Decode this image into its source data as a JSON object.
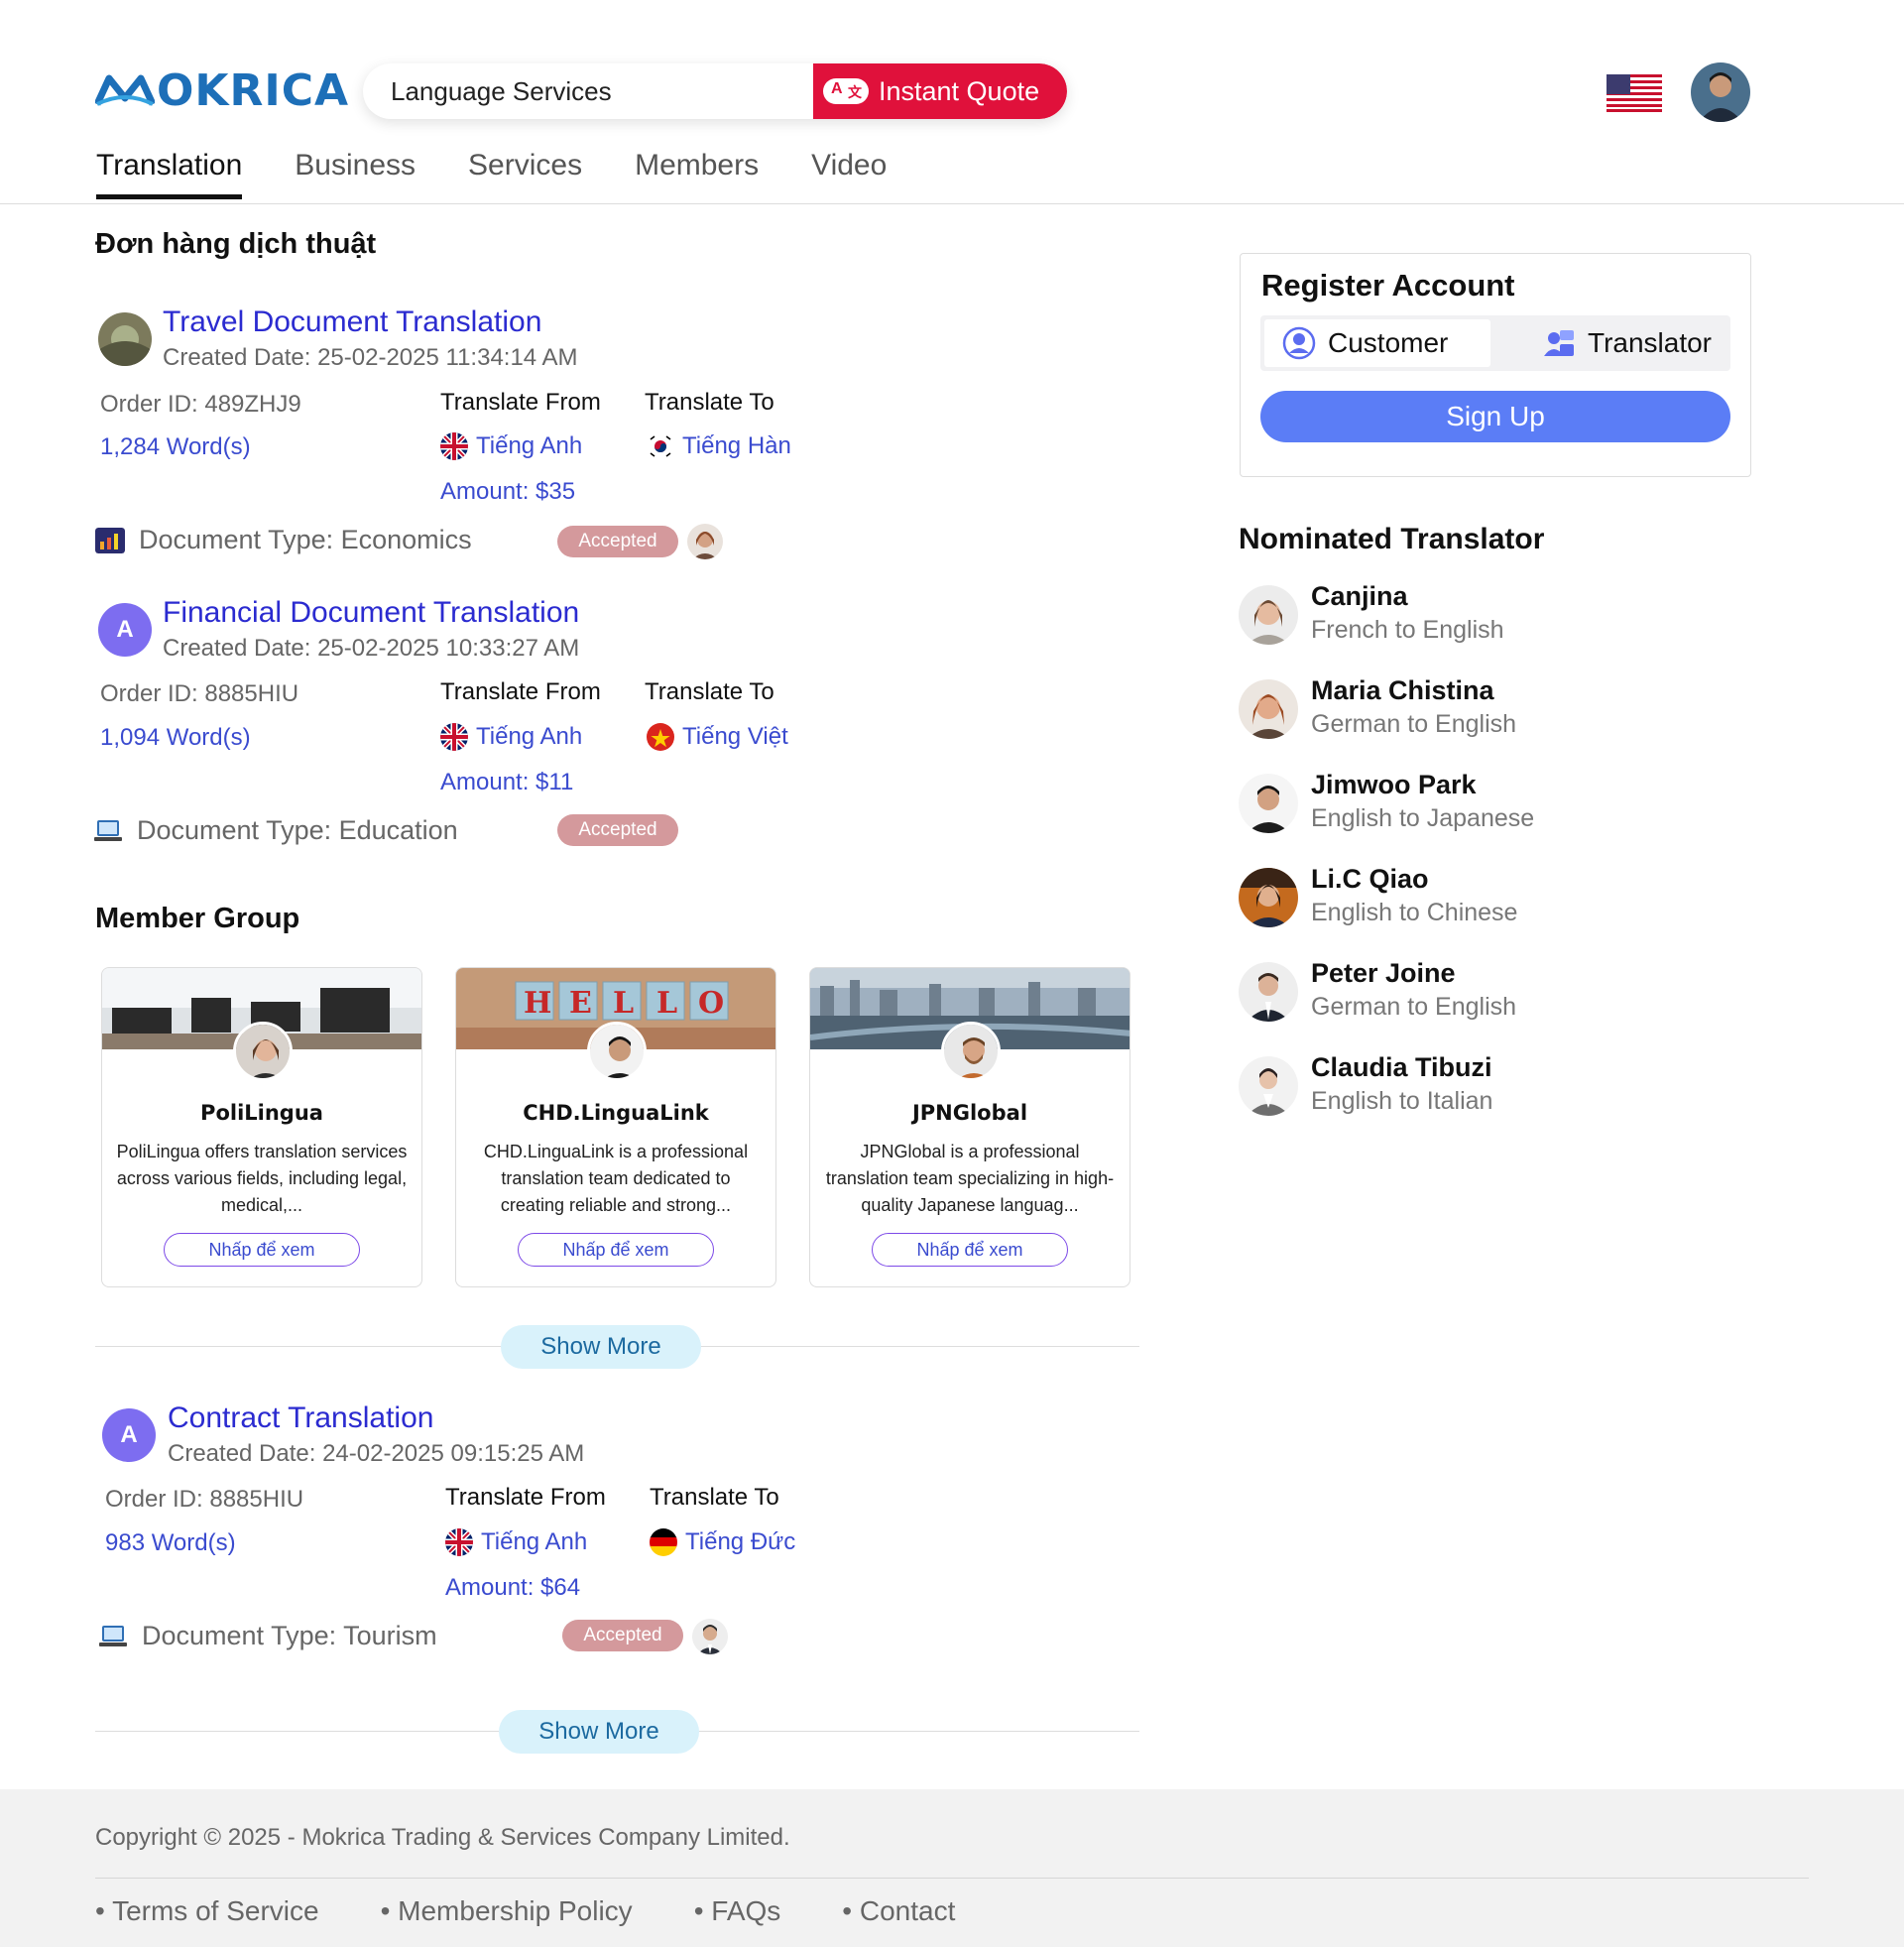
{
  "header": {
    "logo_text": "OKRICA",
    "search_value": "Language Services",
    "quote_button": "Instant Quote"
  },
  "nav": {
    "tabs": [
      "Translation",
      "Business",
      "Services",
      "Members",
      "Video"
    ],
    "active": "Translation"
  },
  "orders_section": {
    "title": "Đơn hàng dịch thuật"
  },
  "orders": [
    {
      "title": "Travel Document Translation",
      "created": "Created Date: 25-02-2025 11:34:14 AM",
      "order_id": "Order ID: 489ZHJ9",
      "words": "1,284 Word(s)",
      "from_label": "Translate From",
      "to_label": "Translate To",
      "from_lang": "Tiếng Anh",
      "to_lang": "Tiếng Hàn",
      "amount": "Amount: $35",
      "doc_type": "Document Type: Economics",
      "status": "Accepted"
    },
    {
      "avatar_letter": "A",
      "title": "Financial Document Translation",
      "created": "Created Date: 25-02-2025 10:33:27 AM",
      "order_id": "Order ID: 8885HIU",
      "words": "1,094 Word(s)",
      "from_label": "Translate From",
      "to_label": "Translate To",
      "from_lang": "Tiếng Anh",
      "to_lang": "Tiếng Việt",
      "amount": "Amount: $11",
      "doc_type": "Document Type: Education",
      "status": "Accepted"
    },
    {
      "avatar_letter": "A",
      "title": "Contract Translation",
      "created": "Created Date: 24-02-2025 09:15:25 AM",
      "order_id": "Order ID: 8885HIU",
      "words": "983 Word(s)",
      "from_label": "Translate From",
      "to_label": "Translate To",
      "from_lang": "Tiếng Anh",
      "to_lang": "Tiếng Đức",
      "amount": "Amount: $64",
      "doc_type": "Document Type: Tourism",
      "status": "Accepted"
    }
  ],
  "member_group": {
    "title": "Member Group",
    "cards": [
      {
        "name": "PoliLingua",
        "desc": "PoliLingua offers translation services across various fields, including legal, medical,...",
        "button": "Nhấp để xem"
      },
      {
        "name": "CHD.LinguaLink",
        "desc": "CHD.LinguaLink is a professional translation team dedicated to creating reliable and strong...",
        "button": "Nhấp để xem"
      },
      {
        "name": "JPNGlobal",
        "desc": "JPNGlobal is a professional translation team specializing in high-quality Japanese languag...",
        "button": "Nhấp để xem"
      }
    ],
    "show_more": "Show More"
  },
  "orders_show_more": "Show More",
  "register": {
    "title": "Register Account",
    "customer": "Customer",
    "translator": "Translator",
    "signup": "Sign Up"
  },
  "nominated": {
    "title": "Nominated Translator",
    "people": [
      {
        "name": "Canjina",
        "langs": "French to English"
      },
      {
        "name": "Maria Chistina",
        "langs": "German to English"
      },
      {
        "name": "Jimwoo Park",
        "langs": "English to Japanese"
      },
      {
        "name": "Li.C Qiao",
        "langs": "English to Chinese"
      },
      {
        "name": "Peter Joine",
        "langs": "German to English"
      },
      {
        "name": "Claudia Tibuzi",
        "langs": "English to Italian"
      }
    ]
  },
  "footer": {
    "copyright": "Copyright © 2025 - Mokrica Trading & Services Company Limited.",
    "links": [
      "• Terms of Service",
      "• Membership Policy",
      "• FAQs",
      "• Contact"
    ]
  },
  "colors": {
    "brand_blue": "#1d6fb8",
    "quote_red": "#e0113b",
    "link_blue": "#3a4bcf",
    "badge": "#d4999c",
    "signup": "#5b7df6"
  }
}
